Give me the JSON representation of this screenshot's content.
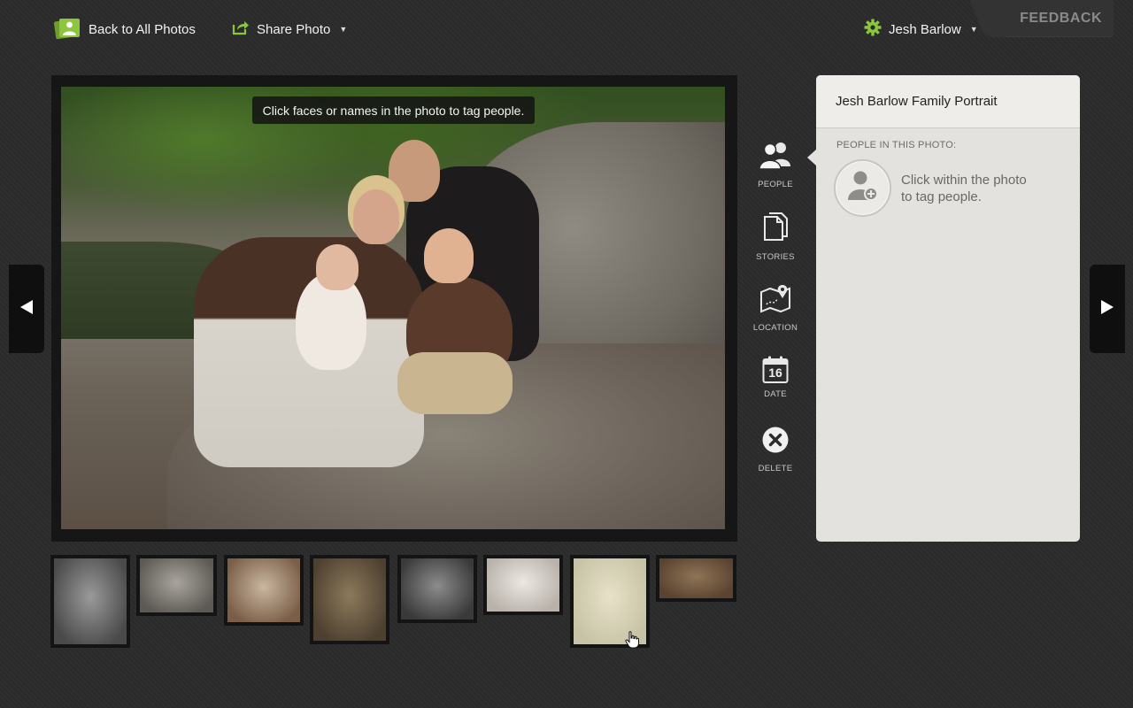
{
  "topbar": {
    "back_label": "Back to All Photos",
    "share_label": "Share Photo",
    "user_name": "Jesh Barlow",
    "feedback_label": "FEEDBACK"
  },
  "colors": {
    "accent": "#8cc63f",
    "background": "#2b2b2b",
    "panel": "#e3e2df"
  },
  "photo": {
    "tag_hint": "Click faces or names in the photo to tag people."
  },
  "tools": [
    {
      "id": "people",
      "label": "PEOPLE",
      "icon": "people-icon"
    },
    {
      "id": "stories",
      "label": "STORIES",
      "icon": "stories-icon"
    },
    {
      "id": "location",
      "label": "LOCATION",
      "icon": "map-pin-icon"
    },
    {
      "id": "date",
      "label": "DATE",
      "icon": "calendar-icon",
      "day": "16"
    },
    {
      "id": "delete",
      "label": "DELETE",
      "icon": "close-circle-icon"
    }
  ],
  "panel": {
    "title": "Jesh Barlow Family Portrait",
    "people_heading": "PEOPLE IN THIS PHOTO:",
    "tag_prompt_line1": "Click within the photo",
    "tag_prompt_line2": "to tag people."
  },
  "filmstrip": [
    {
      "tone": "#4a4a4a",
      "tone2": "#9a9a9a"
    },
    {
      "tone": "#5d5a55",
      "tone2": "#a9a59d"
    },
    {
      "tone": "#7b5e48",
      "tone2": "#c9b7a0"
    },
    {
      "tone": "#4d4030",
      "tone2": "#8d7a5c"
    },
    {
      "tone": "#3a3a3a",
      "tone2": "#8c8c8c"
    },
    {
      "tone": "#b8b2aa",
      "tone2": "#ece8e2"
    },
    {
      "tone": "#c7c3a6",
      "tone2": "#e7e2c8"
    },
    {
      "tone": "#5a4330",
      "tone2": "#8f7456"
    }
  ]
}
